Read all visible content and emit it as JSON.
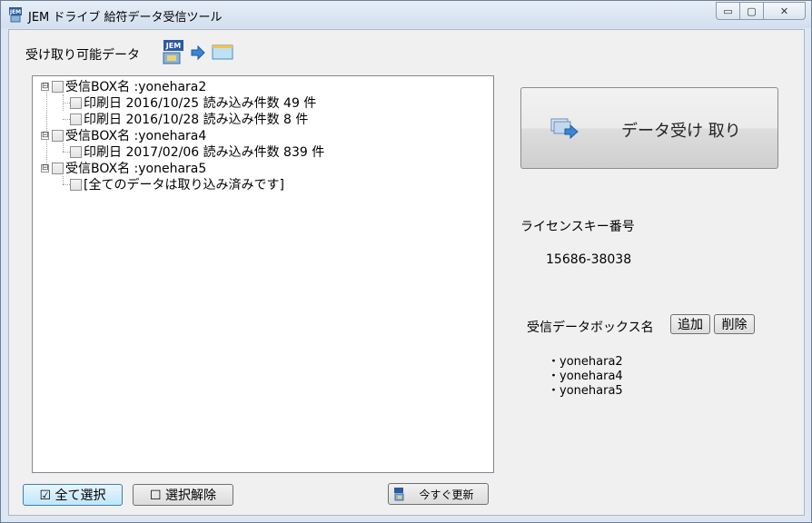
{
  "window": {
    "title": "JEM ドライブ 給符データ受信ツール",
    "controls": {
      "minimize": "▭",
      "maximize": "▢",
      "close": "✕"
    }
  },
  "tree": {
    "section_label": "受け取り可能データ",
    "items": [
      {
        "label": "受信BOX名 :yonehara2",
        "expander": "⊟",
        "children": [
          {
            "label": "印刷日 2016/10/25 読み込み件数 49 件"
          },
          {
            "label": "印刷日 2016/10/28 読み込み件数 8 件"
          }
        ]
      },
      {
        "label": "受信BOX名 :yonehara4",
        "expander": "⊟",
        "children": [
          {
            "label": "印刷日 2017/02/06 読み込み件数 839 件"
          }
        ]
      },
      {
        "label": "受信BOX名 :yonehara5",
        "expander": "⊟",
        "children": [
          {
            "label": "[全てのデータは取り込み済みです]"
          }
        ]
      }
    ]
  },
  "receive_button": {
    "label": "データ受け 取り"
  },
  "license": {
    "label": "ライセンスキー番号",
    "value": "15686-38038"
  },
  "boxes": {
    "label": "受信データボックス名",
    "add_label": "追加",
    "delete_label": "削除",
    "items": [
      "yonehara2",
      "yonehara4",
      "yonehara5"
    ]
  },
  "footer": {
    "select_all_label": "☑ 全て選択",
    "deselect_label": "☐ 選択解除",
    "refresh_label": "今すぐ更新"
  },
  "icons": {
    "app": "jem-app-icon",
    "arrow": "right-arrow-icon",
    "folder": "window-folder-icon",
    "receive": "receive-data-icon",
    "refresh": "refresh-icon"
  },
  "colors": {
    "window_frame": "#dce7f3",
    "client_bg": "#f0f0f0",
    "accent": "#3c7fb1"
  }
}
